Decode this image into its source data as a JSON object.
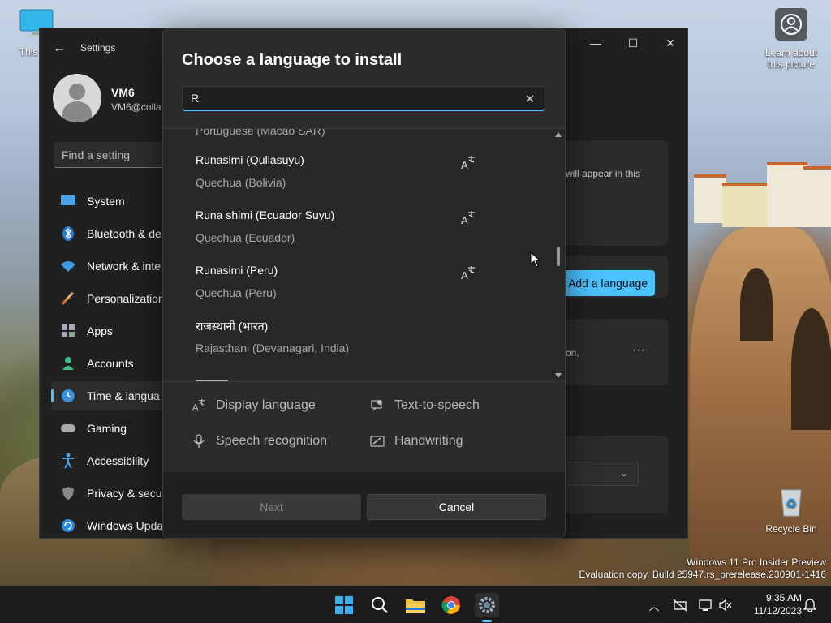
{
  "desktop": {
    "this_pc_label": "This PC",
    "learn_label_line1": "Learn about",
    "learn_label_line2": "this picture",
    "recycle_label": "Recycle Bin",
    "watermark_line1": "Windows 11 Pro Insider Preview",
    "watermark_line2": "Evaluation copy. Build 25947.rs_prerelease.230901-1416"
  },
  "settings": {
    "title": "Settings",
    "user_name": "VM6",
    "user_email": "VM6@colla",
    "search_placeholder": "Find a setting",
    "nav": [
      {
        "label": "System"
      },
      {
        "label": "Bluetooth & de"
      },
      {
        "label": "Network & inte"
      },
      {
        "label": "Personalization"
      },
      {
        "label": "Apps"
      },
      {
        "label": "Accounts"
      },
      {
        "label": "Time & langua"
      },
      {
        "label": "Gaming"
      },
      {
        "label": "Accessibility"
      },
      {
        "label": "Privacy & secu"
      },
      {
        "label": "Windows Upda"
      }
    ],
    "card_text": "will appear in this",
    "add_language_label": "Add a language",
    "card2_text": "on,",
    "more_label": "···"
  },
  "dialog": {
    "title": "Choose a language to install",
    "search_value": "R",
    "partial_top": "Portuguese (Macao SAR)",
    "languages": [
      {
        "name": "Runasimi (Qullasuyu)",
        "sub": "Quechua (Bolivia)"
      },
      {
        "name": "Runa shimi (Ecuador Suyu)",
        "sub": "Quechua (Ecuador)"
      },
      {
        "name": "Runasimi (Peru)",
        "sub": "Quechua (Peru)"
      },
      {
        "name": "राजस्थानी (भारत)",
        "sub": "Rajasthani (Devanagari, India)"
      }
    ],
    "features": {
      "display": "Display language",
      "tts": "Text-to-speech",
      "speech": "Speech recognition",
      "handwriting": "Handwriting"
    },
    "next_label": "Next",
    "cancel_label": "Cancel"
  },
  "taskbar": {
    "time": "9:35 AM",
    "date": "11/12/2023"
  },
  "colors": {
    "accent": "#4cc2ff",
    "dialog_bg": "#2b2b2b",
    "taskbar_bg": "#1c1c1c"
  }
}
